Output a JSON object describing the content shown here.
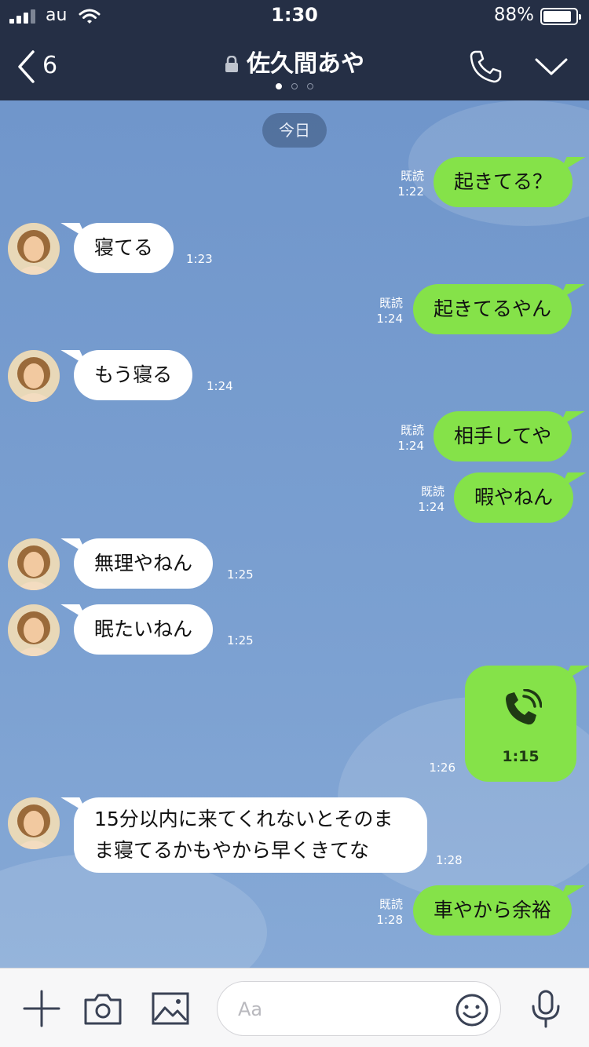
{
  "status": {
    "carrier": "au",
    "time": "1:30",
    "battery": "88%",
    "battery_level": 0.88
  },
  "header": {
    "back_count": "6",
    "title": "佐久間あや"
  },
  "chat": {
    "date_label": "今日",
    "messages": [
      {
        "dir": "out",
        "text": "起きてる？",
        "read": "既読",
        "time": "1:22"
      },
      {
        "dir": "in",
        "text": "寝てる",
        "time": "1:23"
      },
      {
        "dir": "out",
        "text": "起きてるやん",
        "read": "既読",
        "time": "1:24"
      },
      {
        "dir": "in",
        "text": "もう寝る",
        "time": "1:24"
      },
      {
        "dir": "out",
        "text": "相手してや",
        "read": "既読",
        "time": "1:24"
      },
      {
        "dir": "out",
        "text": "暇やねん",
        "read": "既読",
        "time": "1:24"
      },
      {
        "dir": "in",
        "text": "無理やねん",
        "time": "1:25"
      },
      {
        "dir": "in",
        "text": "眠たいねん",
        "time": "1:25"
      },
      {
        "dir": "out",
        "type": "call",
        "duration": "1:15",
        "time": "1:26"
      },
      {
        "dir": "in",
        "text": "15分以内に来てくれないとそのまま寝てるかもやから早くきてな",
        "time": "1:28"
      },
      {
        "dir": "out",
        "text": "車やから余裕",
        "read": "既読",
        "time": "1:28"
      }
    ]
  },
  "input": {
    "placeholder": "Aa"
  },
  "icons": {
    "back": "chevron-left-icon",
    "lock": "lock-icon",
    "call": "phone-icon",
    "menu": "chevron-down-icon",
    "plus": "plus-icon",
    "camera": "camera-icon",
    "image": "image-icon",
    "emoji": "smile-icon",
    "mic": "microphone-icon"
  },
  "colors": {
    "header": "#252f45",
    "bubble_out": "#85e249",
    "bubble_in": "#ffffff",
    "chat_bg": "#7a9ccc"
  }
}
